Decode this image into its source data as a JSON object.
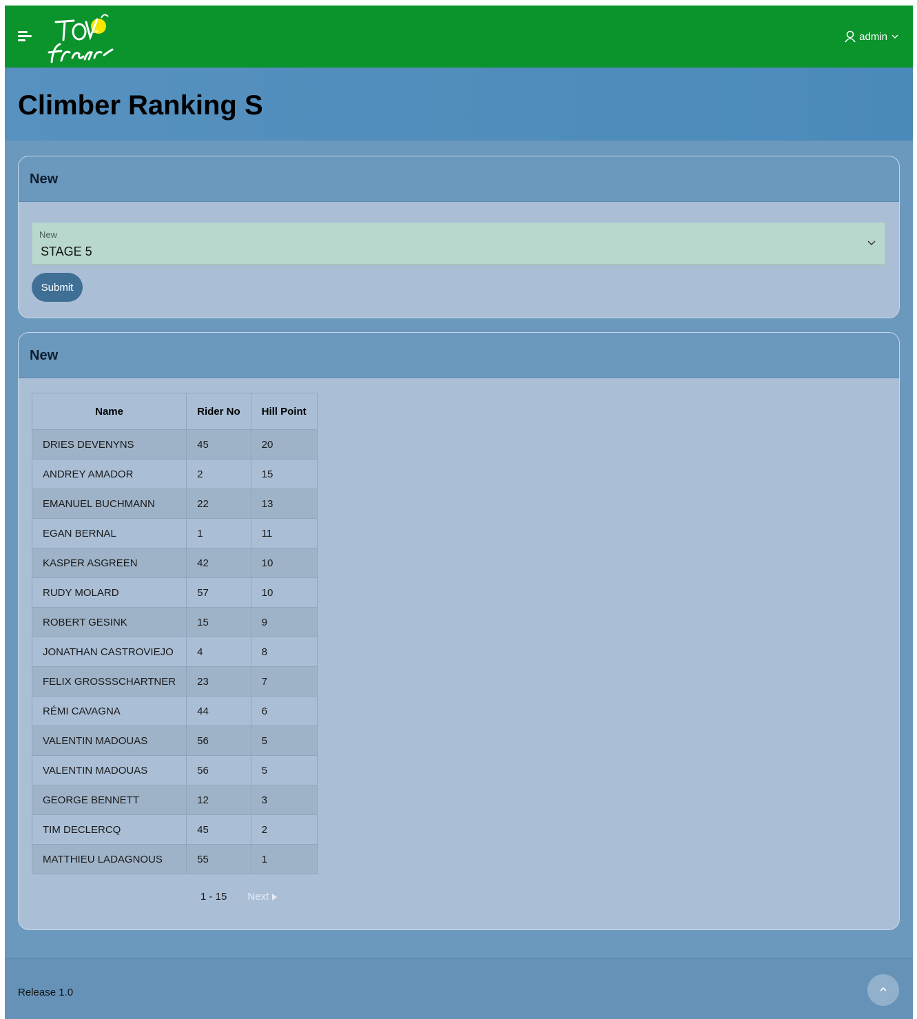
{
  "topbar": {
    "user_name": "admin",
    "logo_text": "Tour de France",
    "brand_color": "#0b932c"
  },
  "header": {
    "title": "Climber Ranking S"
  },
  "form_card": {
    "title": "New",
    "select_label": "New",
    "select_value": "STAGE 5",
    "submit_label": "Submit"
  },
  "table_card": {
    "title": "New",
    "columns": [
      "Name",
      "Rider No",
      "Hill Point"
    ],
    "rows": [
      [
        "DRIES DEVENYNS",
        "45",
        "20"
      ],
      [
        "ANDREY AMADOR",
        "2",
        "15"
      ],
      [
        "EMANUEL BUCHMANN",
        "22",
        "13"
      ],
      [
        "EGAN BERNAL",
        "1",
        "11"
      ],
      [
        "KASPER ASGREEN",
        "42",
        "10"
      ],
      [
        "RUDY MOLARD",
        "57",
        "10"
      ],
      [
        "ROBERT GESINK",
        "15",
        "9"
      ],
      [
        "JONATHAN CASTROVIEJO",
        "4",
        "8"
      ],
      [
        "FELIX GROSSSCHARTNER",
        "23",
        "7"
      ],
      [
        "RÉMI CAVAGNA",
        "44",
        "6"
      ],
      [
        "VALENTIN MADOUAS",
        "56",
        "5"
      ],
      [
        "VALENTIN MADOUAS",
        "56",
        "5"
      ],
      [
        "GEORGE BENNETT",
        "12",
        "3"
      ],
      [
        "TIM DECLERCQ",
        "45",
        "2"
      ],
      [
        "MATTHIEU LADAGNOUS",
        "55",
        "1"
      ]
    ],
    "pager_range": "1 - 15",
    "pager_next": "Next"
  },
  "footer": {
    "release": "Release 1.0"
  },
  "icons": {
    "menu": "menu-icon",
    "user": "user-icon",
    "chevron": "chevron-down-icon",
    "next": "triangle-right-icon",
    "scroll_top": "chevron-up-icon"
  }
}
